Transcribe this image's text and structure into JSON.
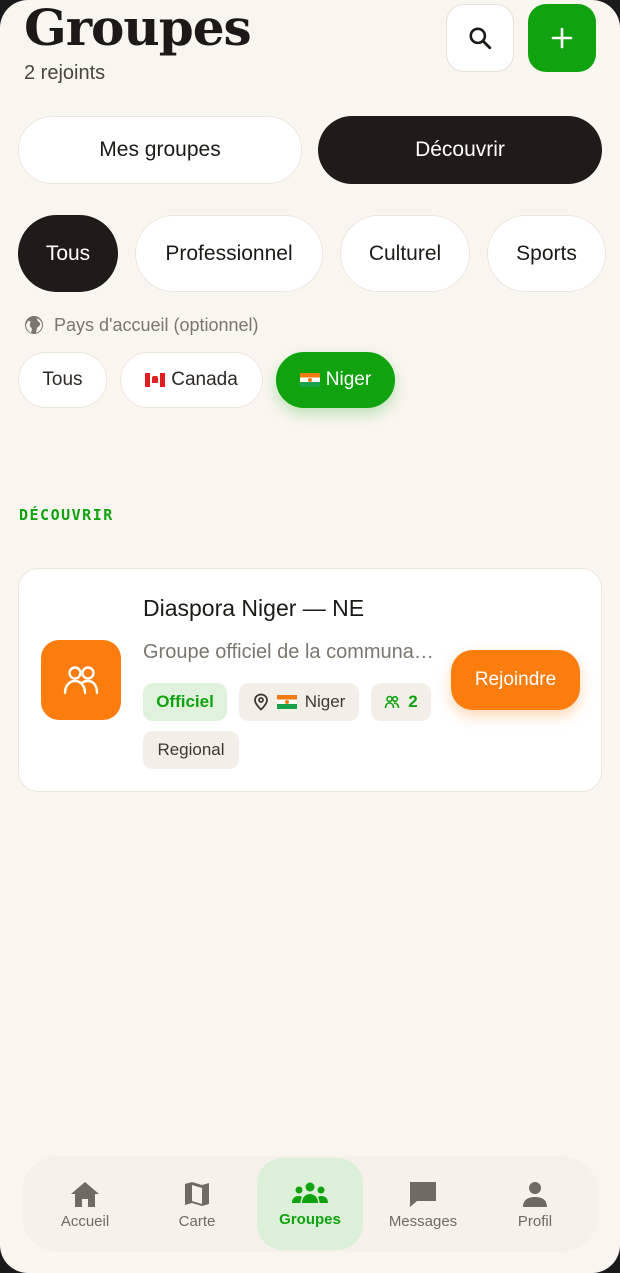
{
  "header": {
    "title": "Groupes",
    "subtitle": "2 rejoints"
  },
  "actions": {
    "search_icon": "search-icon",
    "add_icon": "plus-icon"
  },
  "segments": {
    "mine": "Mes groupes",
    "discover": "Découvrir",
    "active": "discover"
  },
  "categories": {
    "all": "Tous",
    "professional": "Professionnel",
    "cultural": "Culturel",
    "sports": "Sports",
    "active": "all"
  },
  "country_filter": {
    "label": "Pays d'accueil (optionnel)",
    "all": "Tous",
    "canada": "Canada",
    "niger": "Niger",
    "active": "niger"
  },
  "section": {
    "label": "DÉCOUVRIR"
  },
  "group_card": {
    "name": "Diaspora Niger — NE",
    "description": "Groupe officiel de la communauté",
    "tag_official": "Officiel",
    "tag_country": "Niger",
    "members": "2",
    "tag_regional": "Regional",
    "join_label": "Rejoindre"
  },
  "nav": {
    "home": "Accueil",
    "map": "Carte",
    "groups": "Groupes",
    "messages": "Messages",
    "profile": "Profil",
    "active": "groups"
  },
  "colors": {
    "background": "#f9f6f0",
    "accent_green": "#11a30f",
    "accent_orange": "#fb7d0e",
    "dark": "#1e1b18"
  }
}
